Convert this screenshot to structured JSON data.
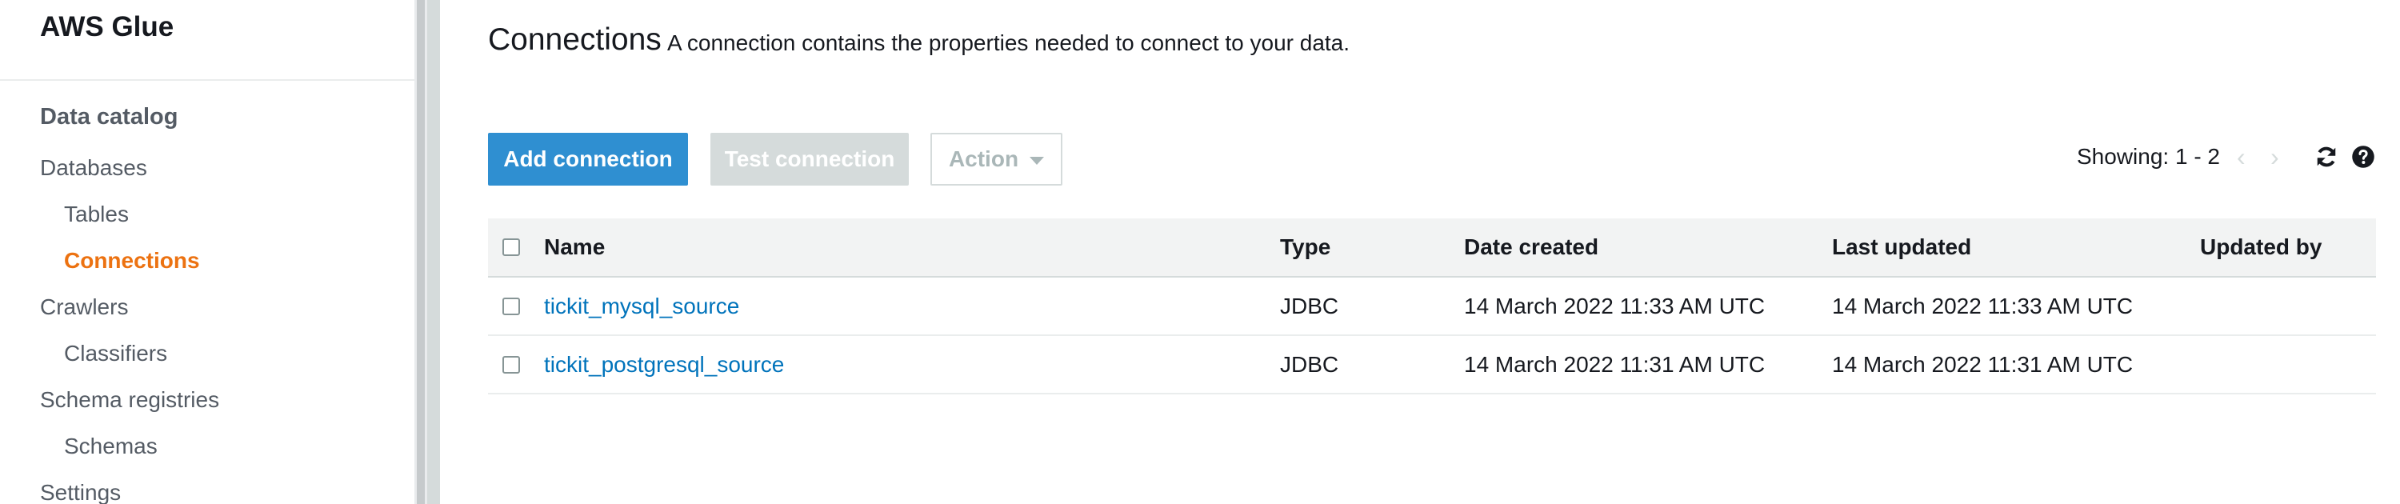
{
  "app": {
    "title": "AWS Glue"
  },
  "sidebar": {
    "section_title": "Data catalog",
    "items": [
      {
        "label": "Databases",
        "level": 1,
        "active": false
      },
      {
        "label": "Tables",
        "level": 2,
        "active": false
      },
      {
        "label": "Connections",
        "level": 2,
        "active": true
      },
      {
        "label": "Crawlers",
        "level": 1,
        "active": false
      },
      {
        "label": "Classifiers",
        "level": 2,
        "active": false
      },
      {
        "label": "Schema registries",
        "level": 1,
        "active": false
      },
      {
        "label": "Schemas",
        "level": 2,
        "active": false
      },
      {
        "label": "Settings",
        "level": 1,
        "active": false
      }
    ]
  },
  "page": {
    "title": "Connections",
    "description": "A connection contains the properties needed to connect to your data."
  },
  "toolbar": {
    "add_label": "Add connection",
    "test_label": "Test connection",
    "action_label": "Action",
    "showing_text": "Showing: 1 - 2",
    "prev_icon": "chevron-left-icon",
    "next_icon": "chevron-right-icon",
    "refresh_icon": "refresh-icon",
    "help_icon": "help-icon"
  },
  "table": {
    "headers": {
      "name": "Name",
      "type": "Type",
      "date_created": "Date created",
      "last_updated": "Last updated",
      "updated_by": "Updated by"
    },
    "rows": [
      {
        "name": "tickit_mysql_source",
        "type": "JDBC",
        "date_created": "14 March 2022 11:33 AM UTC",
        "last_updated": "14 March 2022 11:33 AM UTC",
        "updated_by": ""
      },
      {
        "name": "tickit_postgresql_source",
        "type": "JDBC",
        "date_created": "14 March 2022 11:31 AM UTC",
        "last_updated": "14 March 2022 11:31 AM UTC",
        "updated_by": ""
      }
    ]
  },
  "colors": {
    "primary": "#2f8fd1",
    "active_nav": "#ec7211",
    "link": "#0073bb",
    "disabled": "#d5dbdb"
  }
}
